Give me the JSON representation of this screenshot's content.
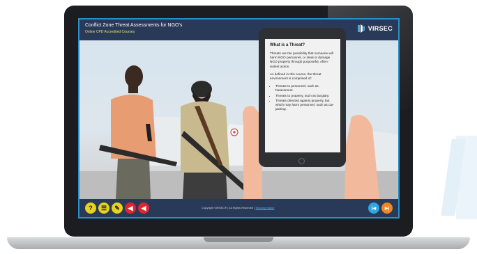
{
  "course": {
    "title": "Conflict Zone Threat Assessments for NGO's",
    "subtitle": "Online CPD Accredited Courses"
  },
  "logo": {
    "text": "VIRSEC",
    "icon": "virsec-logo-icon"
  },
  "phone": {
    "heading": "What is a Threat?",
    "para1": "Threats are the possibility that someone will harm NGO personnel, or steal or damage NGO property through purposeful, often-violent action.",
    "para2": "As defined in this course, the threat environment is comprised of:",
    "bullets": [
      "Threats to personnel, such as harassment.",
      "Threats to property, such as burglary.",
      "Threats directed against property, but which may harm personnel, such as car-jacking."
    ]
  },
  "footer": {
    "copyright": "Copyright VIRSEC® | All Rights Reserved |",
    "link": "Security Notice",
    "buttons": [
      {
        "name": "help-button",
        "symbol": "?",
        "color": "#e8d21e"
      },
      {
        "name": "menu-button",
        "symbol": "☰",
        "color": "#e8d21e"
      },
      {
        "name": "notes-button",
        "symbol": "✎",
        "color": "#e8d21e"
      },
      {
        "name": "audio-button",
        "symbol": "◀",
        "color": "#e0262e"
      },
      {
        "name": "mute-button",
        "symbol": "◀",
        "color": "#e0262e"
      }
    ],
    "nav": [
      {
        "name": "previous-button",
        "symbol": "|◀",
        "color": "#2fa6e0"
      },
      {
        "name": "next-button",
        "symbol": "▶|",
        "color": "#f0871f"
      }
    ]
  }
}
